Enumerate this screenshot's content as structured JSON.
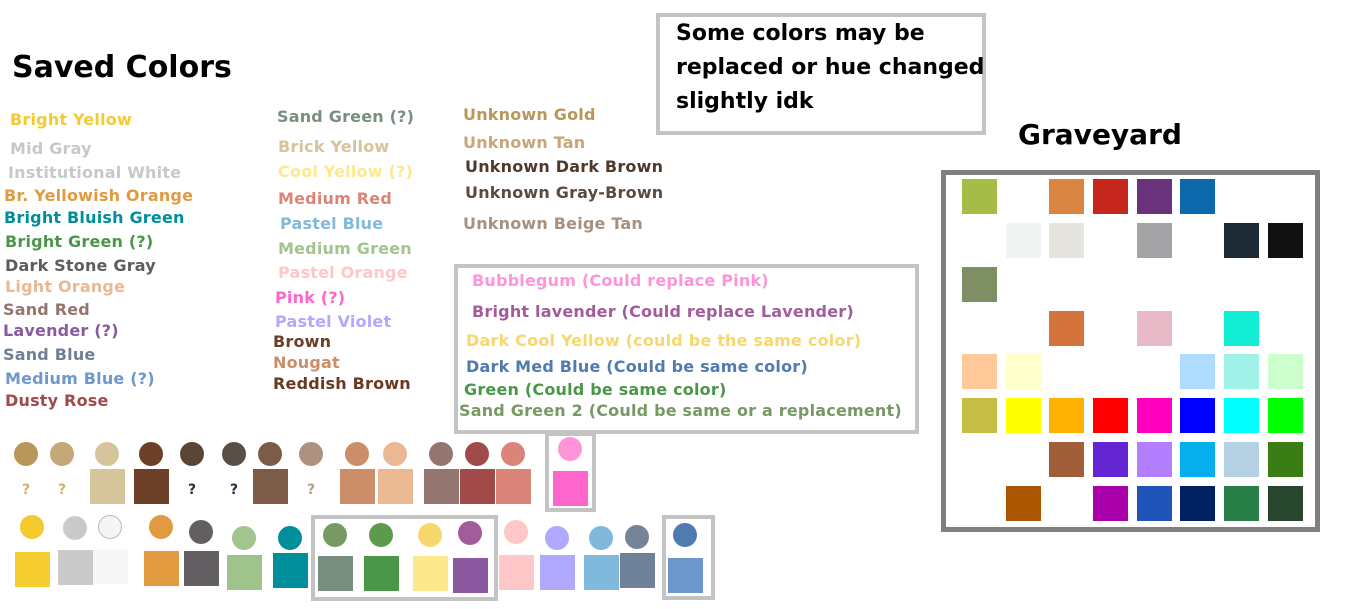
{
  "title": "Saved Colors",
  "note": {
    "lines": [
      "Some colors may be",
      "replaced or hue changed",
      "slightly idk"
    ]
  },
  "graveyard_title": "Graveyard",
  "labels_col1": [
    {
      "text": "Bright Yellow",
      "color": "#f5c930"
    },
    {
      "text": "Mid Gray",
      "color": "#c8c8c8"
    },
    {
      "text": "Institutional White",
      "color": "#c8c8c8"
    },
    {
      "text": "Br. Yellowish Orange",
      "color": "#e19a3f"
    },
    {
      "text": "Bright Bluish Green",
      "color": "#008e9b"
    },
    {
      "text": "Bright Green (?)",
      "color": "#4b974a"
    },
    {
      "text": "Dark Stone Gray",
      "color": "#5f5c5f"
    },
    {
      "text": "Light Orange",
      "color": "#eab893"
    },
    {
      "text": "Sand Red",
      "color": "#95756f"
    },
    {
      "text": "Lavender (?)",
      "color": "#8b59a0"
    },
    {
      "text": "Sand Blue",
      "color": "#6f8096"
    },
    {
      "text": "Medium Blue (?)",
      "color": "#6e98cb"
    },
    {
      "text": "Dusty Rose",
      "color": "#a04a4a"
    }
  ],
  "labels_col2": [
    {
      "text": "Sand Green (?)",
      "color": "#788f80"
    },
    {
      "text": "Brick Yellow",
      "color": "#d6c49a"
    },
    {
      "text": "Cool Yellow (?)",
      "color": "#fde88c"
    },
    {
      "text": "Medium Red",
      "color": "#da8579"
    },
    {
      "text": "Pastel Blue",
      "color": "#80b9db"
    },
    {
      "text": "Medium Green",
      "color": "#a2c48d"
    },
    {
      "text": "Pastel Orange",
      "color": "#ffc7c7"
    },
    {
      "text": "Pink (?)",
      "color": "#ff66cc"
    },
    {
      "text": "Pastel Violet",
      "color": "#b1a8ff"
    },
    {
      "text": "Brown",
      "color": "#6b4027"
    },
    {
      "text": "Nougat",
      "color": "#cc8e68"
    },
    {
      "text": "Reddish Brown",
      "color": "#6a3a20"
    }
  ],
  "labels_col3": [
    {
      "text": "Unknown Gold",
      "color": "#b9965a"
    },
    {
      "text": "Unknown Tan",
      "color": "#c6a878"
    },
    {
      "text": "Unknown Dark Brown",
      "color": "#4d3a2c"
    },
    {
      "text": "Unknown Gray-Brown",
      "color": "#5a4a40"
    },
    {
      "text": "Unknown Beige Tan",
      "color": "#a8907e"
    }
  ],
  "replacements": [
    {
      "text": "Bubblegum (Could replace Pink)",
      "color": "#ff94da"
    },
    {
      "text": "Bright lavender (Could replace Lavender)",
      "color": "#a35c9b"
    },
    {
      "text": "Dark Cool Yellow (could be the same color)",
      "color": "#f8d76c"
    },
    {
      "text": "Dark Med Blue (Could be same color)",
      "color": "#507bb0"
    },
    {
      "text": "Green (Could be same color)",
      "color": "#4b974a"
    },
    {
      "text": "Sand Green 2 (Could be same or a replacement)",
      "color": "#779a64"
    }
  ],
  "row1_swatches": [
    {
      "circle": "#b9965a",
      "square": null,
      "question": "?",
      "qcolor": "#d6b06a"
    },
    {
      "circle": "#c6a878",
      "square": null,
      "question": "?",
      "qcolor": "#d6b06a"
    },
    {
      "circle": "#d6c49a",
      "square": "#d6c49a",
      "question": null
    },
    {
      "circle": "#6b4027",
      "square": "#6b4027",
      "question": null
    },
    {
      "circle": "#5a4536",
      "square": null,
      "question": "?",
      "qcolor": "#2a3040"
    },
    {
      "circle": "#5a4e46",
      "square": null,
      "question": "?",
      "qcolor": "#2a3040"
    },
    {
      "circle": "#7c5b47",
      "square": "#7c5b47",
      "question": null
    },
    {
      "circle": "#ad9281",
      "square": null,
      "question": "?",
      "qcolor": "#b0a090"
    },
    {
      "circle": "#cc8e68",
      "square": "#cc8e68",
      "question": null
    },
    {
      "circle": "#eab893",
      "square": "#eab893",
      "question": null
    },
    {
      "circle": "#95756f",
      "square": "#95756f",
      "question": null
    },
    {
      "circle": "#a04a4a",
      "square": "#a04a4a",
      "question": null
    },
    {
      "circle": "#da8579",
      "square": "#da8579",
      "question": null
    },
    {
      "circle": "#ff94da",
      "square": "#ff66cc",
      "question": null
    }
  ],
  "row2_swatches": [
    {
      "circle": "#f5c930",
      "square": "#f5cd30"
    },
    {
      "circle": "#cacaca",
      "square": "#cacaca"
    },
    {
      "circle": "#f5f5f5",
      "square": "#f7f7f7"
    },
    {
      "circle": "#e19a3f",
      "square": "#e19a3f"
    },
    {
      "circle": "#645f63",
      "square": "#645f63"
    },
    {
      "circle": "#a2c48d",
      "square": "#a0c38b"
    },
    {
      "circle": "#008e9b",
      "square": "#008e9b"
    },
    {
      "circle": "#779a64",
      "square": "#788f80"
    },
    {
      "circle": "#5c9a4e",
      "square": "#4b974a"
    },
    {
      "circle": "#f8d76c",
      "square": "#fde88c"
    },
    {
      "circle": "#a35c9b",
      "square": "#8b59a0"
    },
    {
      "circle": "#ffc7c7",
      "square": "#ffc7c7"
    },
    {
      "circle": "#b1a8ff",
      "square": "#b1a8ff"
    },
    {
      "circle": "#80b9db",
      "square": "#80b9db"
    },
    {
      "circle": "#758499",
      "square": "#70829a"
    },
    {
      "circle": "#507bb0",
      "square": "#6e98cb"
    }
  ],
  "graveyard": [
    [
      "#a5bd47",
      null,
      "#da8541",
      "#c4281c",
      "#6b327c",
      "#0d69ac",
      null,
      null
    ],
    [
      null,
      "#f2f3f3",
      "#e5e4df",
      null,
      "#a3a2a5",
      null,
      "#1b2a35",
      "#111111"
    ],
    [
      "#7f8f64",
      null,
      null,
      null,
      null,
      null,
      null,
      null
    ],
    [
      null,
      null,
      "#d5733d",
      null,
      "#e8bac8",
      null,
      "#12eed4",
      null
    ],
    [
      "#ffc999",
      "#ffffcc",
      null,
      null,
      null,
      "#afdcfe",
      "#a0f2e8",
      "#ccffcc"
    ],
    [
      "#c4be45",
      "#ffff00",
      "#ffb000",
      "#ff0000",
      "#ff00bf",
      "#0000ff",
      "#00ffff",
      "#00ff00"
    ],
    [
      null,
      null,
      "#a05f38",
      "#6425d3",
      "#b37fff",
      "#04afec",
      "#b4d2e4",
      "#3a7d15"
    ],
    [
      null,
      "#aa5500",
      null,
      "#aa00aa",
      "#2154b9",
      "#002060",
      "#287f47",
      "#27462d"
    ]
  ]
}
